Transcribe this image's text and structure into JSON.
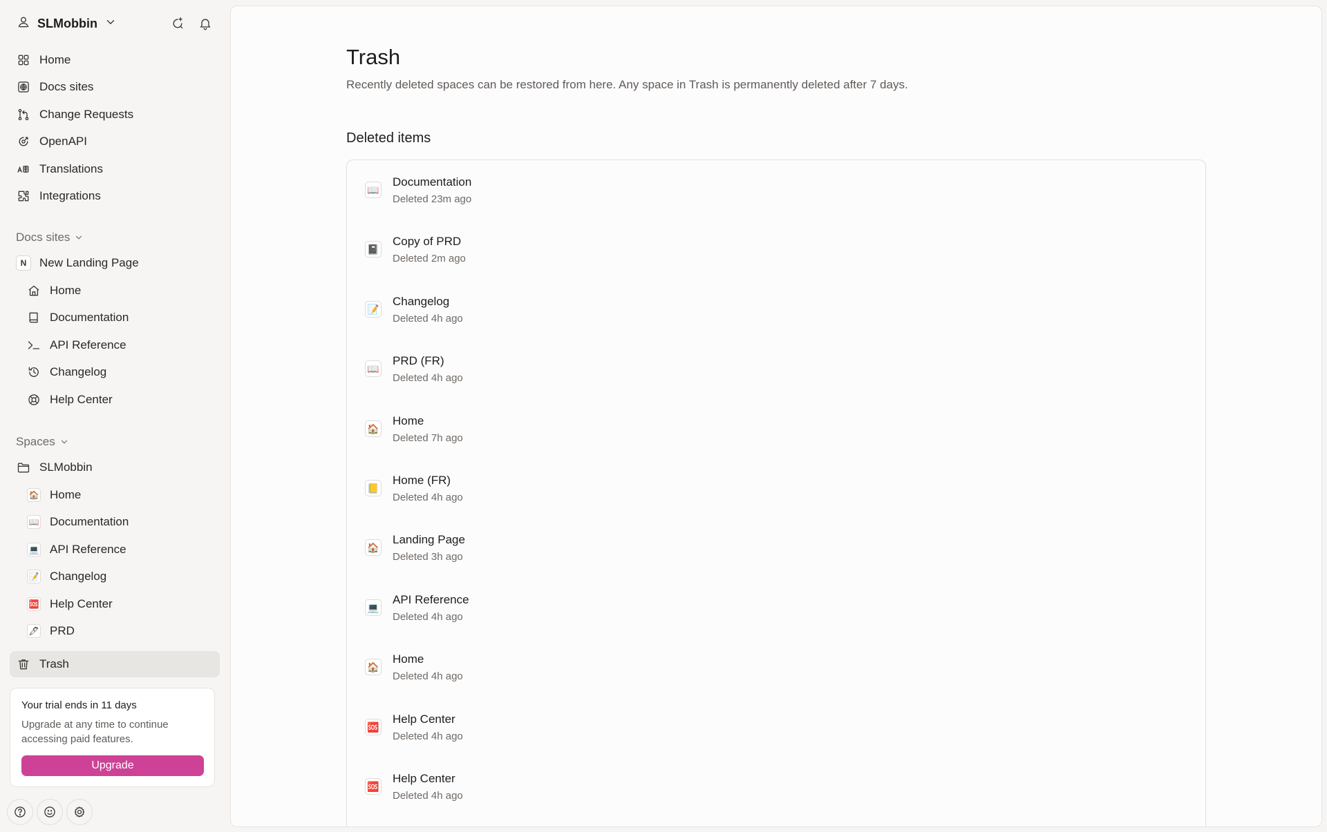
{
  "org": {
    "name": "SLMobbin"
  },
  "nav": [
    {
      "label": "Home",
      "icon": "grid-icon",
      "name": "nav-home"
    },
    {
      "label": "Docs sites",
      "icon": "globe-icon",
      "name": "nav-docs-sites"
    },
    {
      "label": "Change Requests",
      "icon": "git-branch-icon",
      "name": "nav-change-requests"
    },
    {
      "label": "OpenAPI",
      "icon": "openapi-icon",
      "name": "nav-openapi"
    },
    {
      "label": "Translations",
      "icon": "translate-icon",
      "name": "nav-translations"
    },
    {
      "label": "Integrations",
      "icon": "puzzle-icon",
      "name": "nav-integrations"
    }
  ],
  "docs_sites": {
    "heading": "Docs sites",
    "site": {
      "label": "New Landing Page",
      "badge": "N"
    },
    "items": [
      {
        "label": "Home",
        "icon": "house-icon"
      },
      {
        "label": "Documentation",
        "icon": "book-icon"
      },
      {
        "label": "API Reference",
        "icon": "terminal-icon"
      },
      {
        "label": "Changelog",
        "icon": "history-icon"
      },
      {
        "label": "Help Center",
        "icon": "lifebuoy-icon"
      }
    ]
  },
  "spaces": {
    "heading": "Spaces",
    "folder": {
      "label": "SLMobbin"
    },
    "items": [
      {
        "label": "Home",
        "emoji": "🏠"
      },
      {
        "label": "Documentation",
        "emoji": "📖"
      },
      {
        "label": "API Reference",
        "emoji": "💻"
      },
      {
        "label": "Changelog",
        "emoji": "📝"
      },
      {
        "label": "Help Center",
        "emoji": "🆘"
      },
      {
        "label": "PRD",
        "emoji": "🖊"
      }
    ]
  },
  "trash_nav": {
    "label": "Trash"
  },
  "trial": {
    "title": "Your trial ends in 11 days",
    "description": "Upgrade at any time to continue accessing paid features.",
    "button": "Upgrade"
  },
  "colors": {
    "accent": "#cd4296",
    "sidebar_bg": "#f6f5f4",
    "active_bg": "#e8e6e3"
  },
  "page": {
    "title": "Trash",
    "description": "Recently deleted spaces can be restored from here. Any space in Trash is permanently deleted after 7 days.",
    "section_title": "Deleted items"
  },
  "deleted_items": [
    {
      "name": "Documentation",
      "time": "Deleted 23m ago",
      "emoji": "📖"
    },
    {
      "name": "Copy of PRD",
      "time": "Deleted 2m ago",
      "emoji": "📓"
    },
    {
      "name": "Changelog",
      "time": "Deleted 4h ago",
      "emoji": "📝"
    },
    {
      "name": "PRD (FR)",
      "time": "Deleted 4h ago",
      "emoji": "📖"
    },
    {
      "name": "Home",
      "time": "Deleted 7h ago",
      "emoji": "🏠"
    },
    {
      "name": "Home (FR)",
      "time": "Deleted 4h ago",
      "emoji": "📒"
    },
    {
      "name": "Landing Page",
      "time": "Deleted 3h ago",
      "emoji": "🏠"
    },
    {
      "name": "API Reference",
      "time": "Deleted 4h ago",
      "emoji": "💻"
    },
    {
      "name": "Home",
      "time": "Deleted 4h ago",
      "emoji": "🏠"
    },
    {
      "name": "Help Center",
      "time": "Deleted 4h ago",
      "emoji": "🆘"
    },
    {
      "name": "Help Center",
      "time": "Deleted 4h ago",
      "emoji": "🆘"
    }
  ]
}
